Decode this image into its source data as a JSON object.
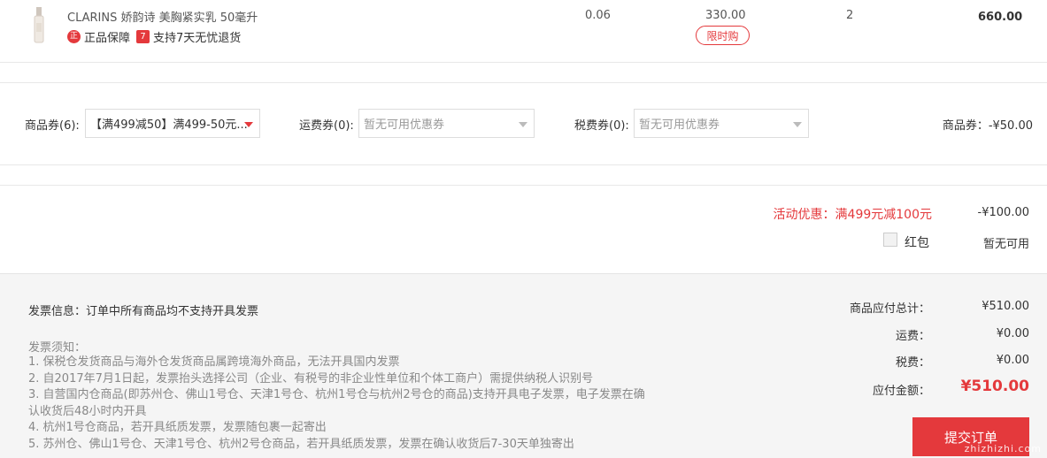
{
  "product": {
    "name": "CLARINS 娇韵诗 美胸紧实乳 50毫升",
    "tag_authentic": "正品保障",
    "tag_authentic_icon": "正",
    "tag_return": "支持7天无忧退货",
    "tag_return_icon": "7",
    "tax": "0.06",
    "price": "330.00",
    "limit_badge": "限时购",
    "qty": "2",
    "total": "660.00"
  },
  "coupons": {
    "goods_label": "商品券(6):",
    "goods_selected": "【满499减50】满499-50元...",
    "shipping_label": "运费券(0):",
    "shipping_selected": "暂无可用优惠券",
    "tax_label": "税费券(0):",
    "tax_selected": "暂无可用优惠券",
    "summary": "商品券：-¥50.00"
  },
  "discount": {
    "promo_label": "活动优惠：满499元减100元",
    "promo_amount": "-¥100.00",
    "redpacket_label": "红包",
    "redpacket_value": "暂无可用"
  },
  "invoice": {
    "info": "发票信息：订单中所有商品均不支持开具发票",
    "notice_title": "发票须知：",
    "notices": [
      "1. 保税仓发货商品与海外仓发货商品属跨境海外商品，无法开具国内发票",
      "2. 自2017年7月1日起，发票抬头选择公司（企业、有税号的非企业性单位和个体工商户）需提供纳税人识别号",
      "3. 自营国内仓商品(即苏州仓、佛山1号仓、天津1号仓、杭州1号仓与杭州2号仓的商品)支持开具电子发票，电子发票在确",
      "认收货后48小时内开具",
      "4. 杭州1号仓商品，若开具纸质发票，发票随包裹一起寄出",
      "5. 苏州仓、佛山1号仓、天津1号仓、杭州2号仓商品，若开具纸质发票，发票在确认收货后7-30天单独寄出"
    ]
  },
  "totals": {
    "goods_label": "商品应付总计：",
    "goods_value": "¥510.00",
    "shipping_label": "运费：",
    "shipping_value": "¥0.00",
    "tax_label": "税费：",
    "tax_value": "¥0.00",
    "due_label": "应付金额：",
    "due_value": "¥510.00",
    "submit": "提交订单"
  },
  "watermark": "zhizhizhi.com",
  "colors": {
    "accent": "#e4393c"
  }
}
